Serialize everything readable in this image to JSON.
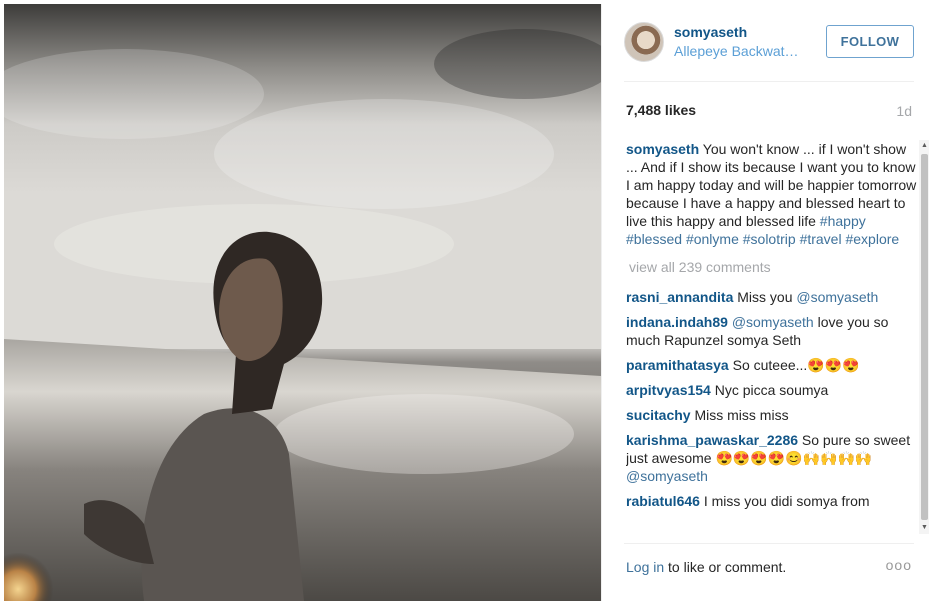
{
  "post": {
    "photo_alt": "",
    "author": {
      "username": "somyaseth",
      "location": "Allepeye Backwat…"
    },
    "follow_label": "FOLLOW",
    "likes": "7,488 likes",
    "time_ago": "1d",
    "caption": {
      "author": "somyaseth",
      "text": "You won't know ... if I won't show ... And if I show its because I want you to know I am happy today and will be happier tomorrow because I have a happy and blessed heart to live this happy and blessed life",
      "hashtags": [
        "#happy",
        "#blessed",
        "#onlyme",
        "#solotrip",
        "#travel",
        "#explore"
      ]
    },
    "view_all": "view all 239 comments",
    "comments": [
      {
        "author": "rasni_annandita",
        "text": "Miss you",
        "mention": "@somyaseth"
      },
      {
        "author": "indana.indah89",
        "mention": "@somyaseth",
        "text": "love you so much Rapunzel somya Seth"
      },
      {
        "author": "paramithatasya",
        "text": "So cuteee...😍😍😍"
      },
      {
        "author": "arpitvyas154",
        "text": "Nyc picca soumya"
      },
      {
        "author": "sucitachy",
        "text": "Miss miss miss"
      },
      {
        "author": "karishma_pawaskar_2286",
        "text": "So pure so sweet just awesome 😍😍😍😍😊🙌🙌🙌🙌",
        "mention": "@somyaseth"
      },
      {
        "author": "rabiatul646",
        "text": "I miss you didi somya from"
      }
    ],
    "footer": {
      "login_label": "Log in",
      "rest_label": " to like or comment.",
      "more_label": "ooo"
    }
  },
  "icons": {
    "scroll_up": "scroll-up-arrow-icon",
    "scroll_down": "scroll-down-arrow-icon",
    "more": "more-options-icon"
  }
}
